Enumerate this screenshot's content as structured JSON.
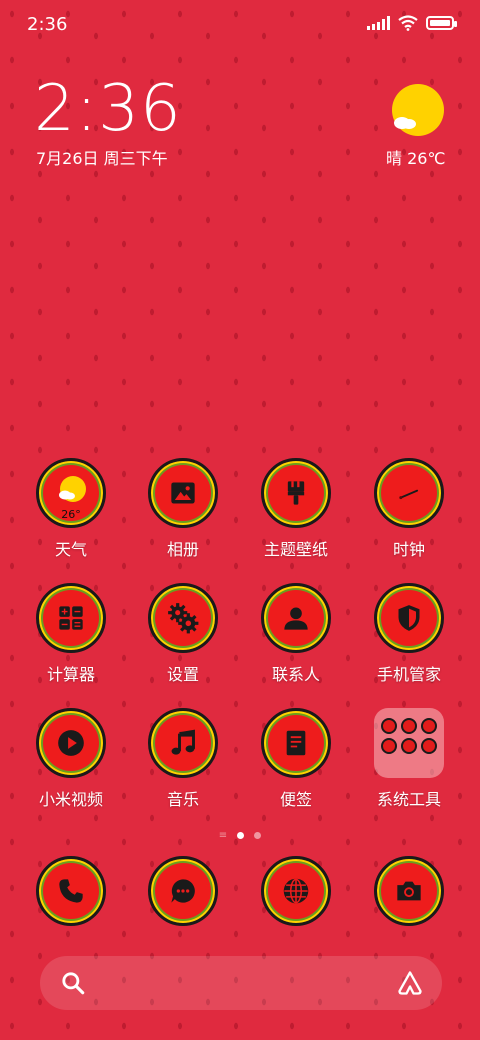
{
  "status_bar": {
    "time": "2:36"
  },
  "clock_widget": {
    "time": "2:36",
    "date": "7月26日 周三下午",
    "weather": "晴 26℃"
  },
  "apps": [
    {
      "label": "天气",
      "icon": "weather-icon",
      "badge": "26°"
    },
    {
      "label": "相册",
      "icon": "gallery-icon"
    },
    {
      "label": "主题壁纸",
      "icon": "brush-icon"
    },
    {
      "label": "时钟",
      "icon": "clock-icon"
    },
    {
      "label": "计算器",
      "icon": "calculator-icon"
    },
    {
      "label": "设置",
      "icon": "gear-icon"
    },
    {
      "label": "联系人",
      "icon": "person-icon"
    },
    {
      "label": "手机管家",
      "icon": "shield-icon"
    },
    {
      "label": "小米视频",
      "icon": "play-icon"
    },
    {
      "label": "音乐",
      "icon": "music-icon"
    },
    {
      "label": "便签",
      "icon": "notes-icon"
    },
    {
      "label": "系统工具",
      "icon": "folder-icon"
    }
  ],
  "dock": [
    {
      "icon": "phone-icon"
    },
    {
      "icon": "message-icon"
    },
    {
      "icon": "globe-icon"
    },
    {
      "icon": "camera-icon"
    }
  ],
  "colors": {
    "background": "#e02a3f",
    "icon_fill": "#ee1c1c",
    "rind_yellow": "#ffd200",
    "rind_green": "#6b9e1f",
    "glyph": "#1a1a1a",
    "sun": "#ffd200"
  }
}
